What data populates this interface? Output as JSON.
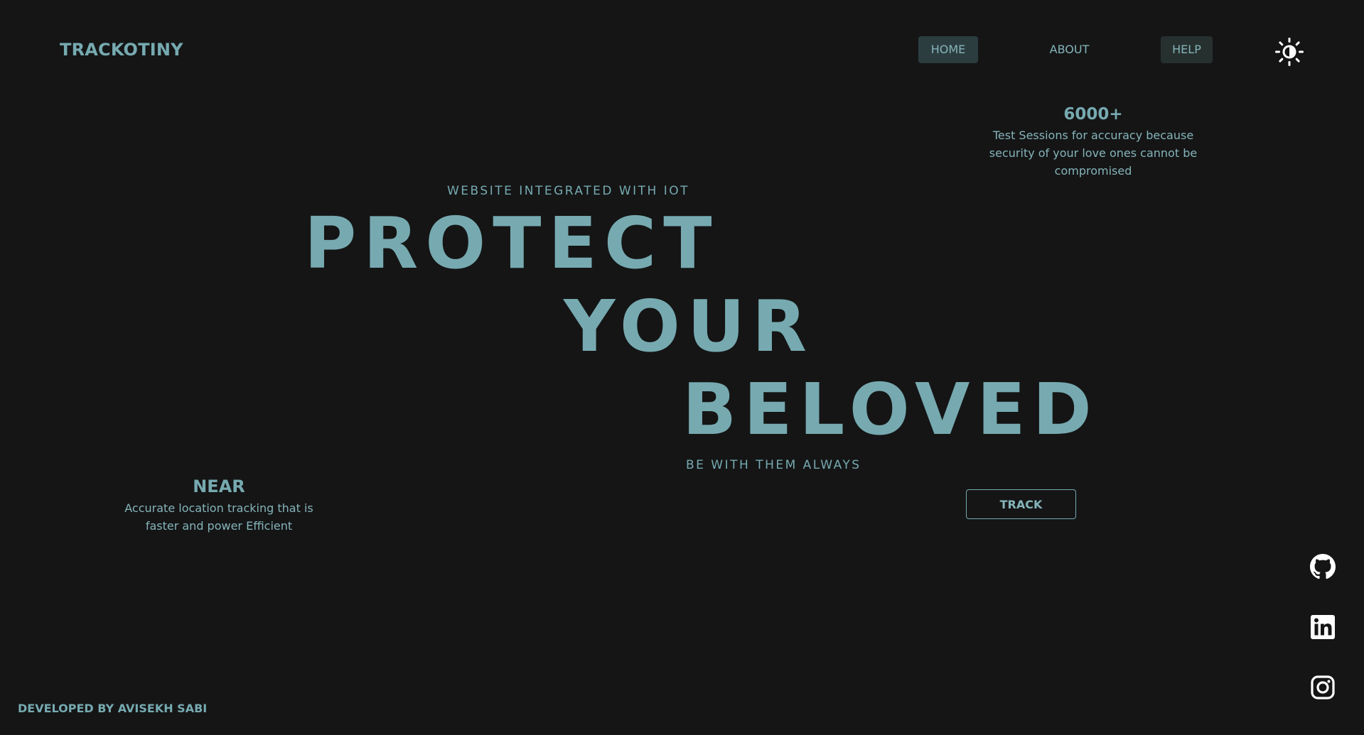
{
  "brand": {
    "logo": "TRACKOTINY"
  },
  "nav": {
    "items": [
      {
        "label": "HOME"
      },
      {
        "label": "ABOUT"
      },
      {
        "label": "HELP"
      }
    ]
  },
  "icons": {
    "theme": "sun-icon",
    "github": "github-icon",
    "linkedin": "linkedin-icon",
    "instagram": "instagram-icon"
  },
  "stat": {
    "value": "6000+",
    "description": "Test Sessions for accuracy because security of your love ones cannot be compromised"
  },
  "hero": {
    "eyebrow": "WEBSITE INTEGRATED WITH IOT",
    "words": [
      "PROTECT",
      "YOUR",
      "BELOVED"
    ],
    "tagline": "BE WITH THEM ALWAYS",
    "cta": "TRACK"
  },
  "near": {
    "title": "NEAR",
    "description": "Accurate location tracking that is faster and power Efficient"
  },
  "footer": {
    "credit": "DEVELOPED BY AVISEKH SABI"
  },
  "colors": {
    "background": "#151516",
    "accent": "#76aab0",
    "nav_active_bg": "#2c3d40"
  }
}
